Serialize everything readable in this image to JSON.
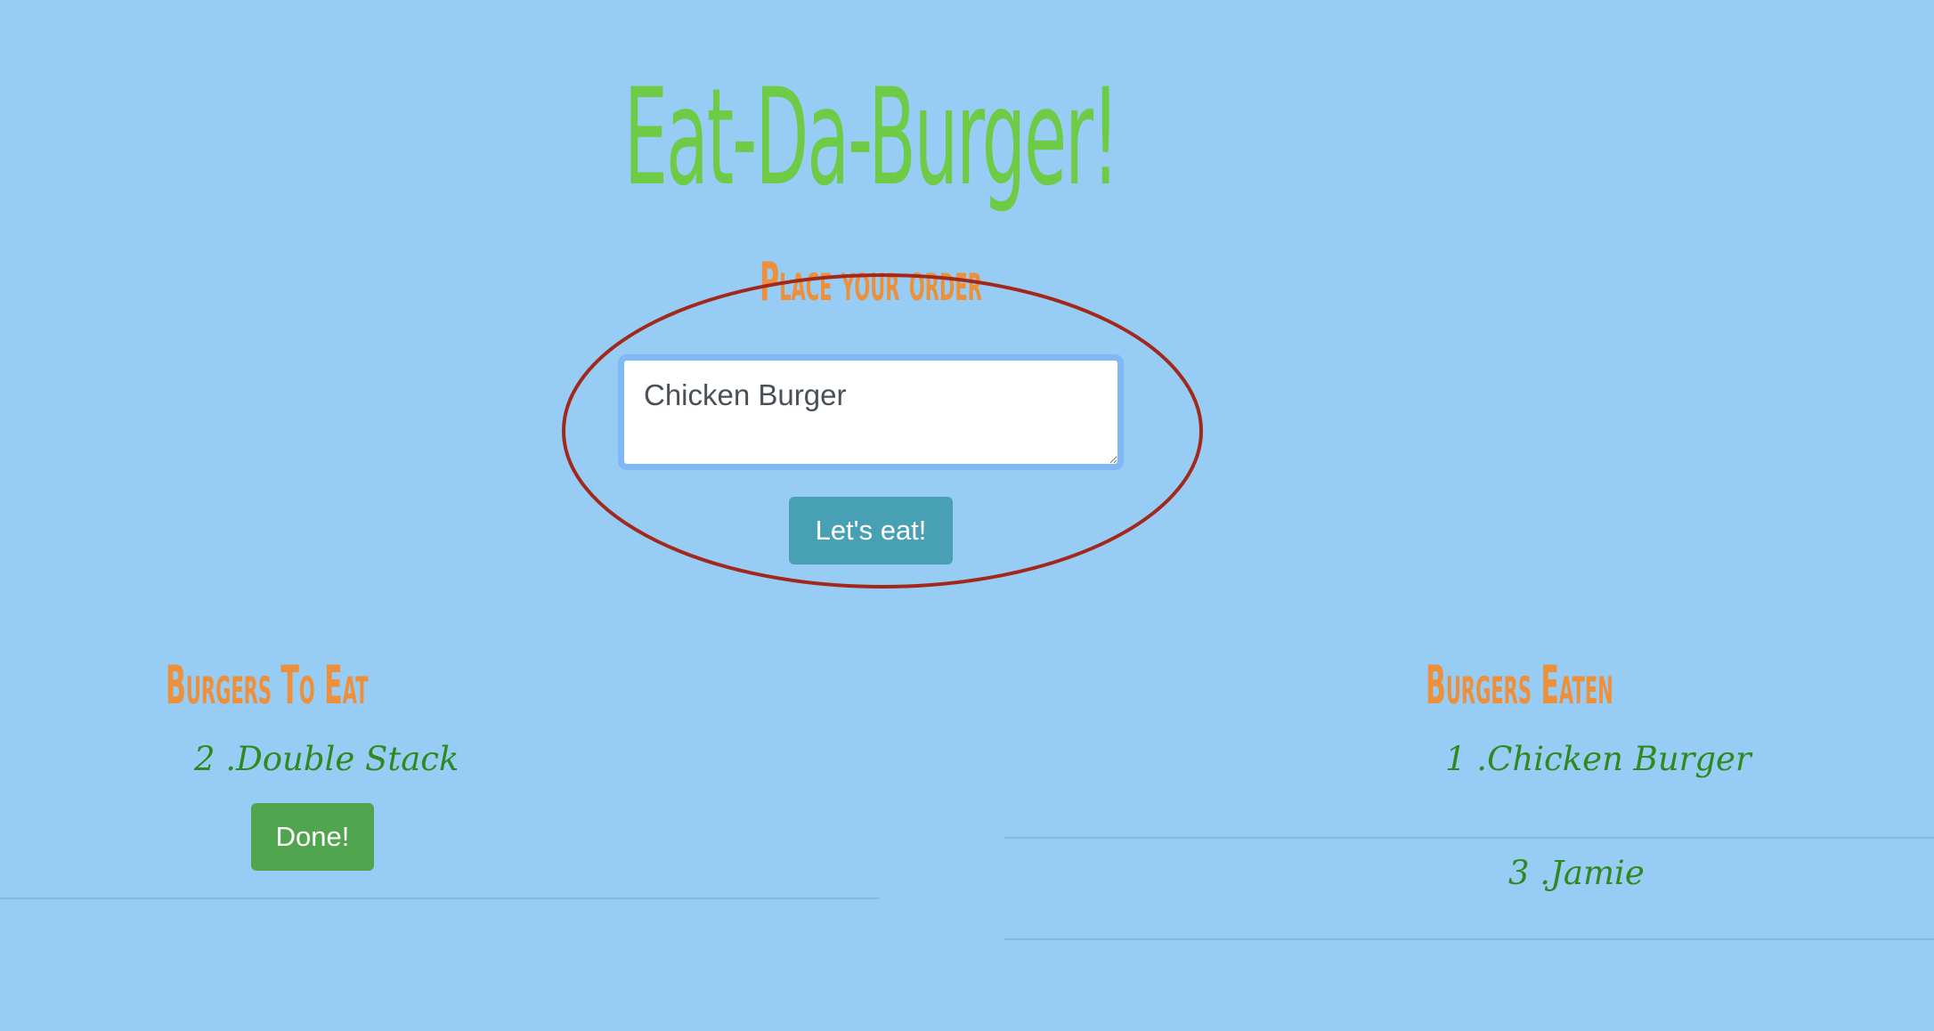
{
  "header": {
    "title": "Eat-Da-Burger!",
    "subtitle": "Place your order"
  },
  "order_form": {
    "input_value": "Chicken Burger",
    "submit_label": "Let's eat!"
  },
  "to_eat": {
    "heading": "Burgers To Eat",
    "items": [
      {
        "label": "2 .Double Stack",
        "button_label": "Done!"
      }
    ]
  },
  "eaten": {
    "heading": "Burgers Eaten",
    "items": [
      {
        "label": "1 .Chicken Burger"
      },
      {
        "label": "3 .Jamie"
      }
    ]
  },
  "colors": {
    "background": "#97ccf4",
    "title": "#6dcb45",
    "heading": "#ee8f3a",
    "item_text": "#2e8a1f",
    "submit_button": "#48a0b5",
    "done_button": "#51a54e",
    "annotation": "#a3281c"
  }
}
